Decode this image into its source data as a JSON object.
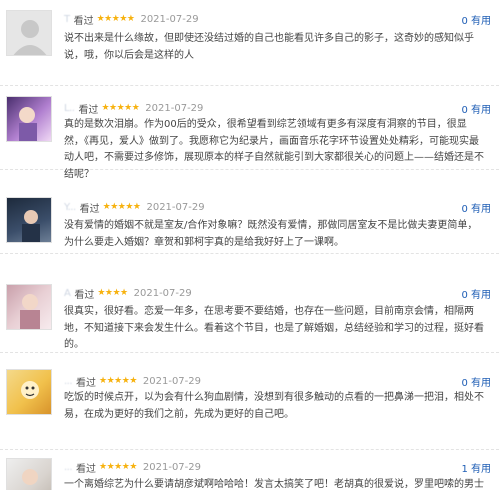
{
  "reviews": [
    {
      "user": "T",
      "action": "看过",
      "stars": "★★★★★",
      "date": "2021-07-29",
      "useful": "0 有用",
      "text": "说不出来是什么缘故，但即使还没结过婚的自己也能看见许多自己的影子，这奇妙的感知似乎说，哦，你以后会是这样的人",
      "avatar": "default-avatar"
    },
    {
      "user": "L..",
      "action": "看过",
      "stars": "★★★★★",
      "date": "2021-07-29",
      "useful": "0 有用",
      "text": "真的是数次泪崩。作为00后的受众，很希望看到综艺领域有更多有深度有洞察的节目，很显然，《再见，爱人》做到了。我愿称它为纪录片，画面音乐花字环节设置处处精彩，可能现实最动人吧，不需要过多修饰，展现原本的样子自然就能引到大家都很关心的问题上——结婚还是不结呢？",
      "avatar": "photo-avatar-purple"
    },
    {
      "user": "Y...",
      "action": "看过",
      "stars": "★★★★★",
      "date": "2021-07-29",
      "useful": "0 有用",
      "text": "没有爱情的婚姻不就是室友/合作对象嘛？既然没有爱情，那做同居室友不是比做夫妻更简单，为什么要走入婚姻？章贺和郭柯宇真的是给我好好上了一课啊。",
      "avatar": "photo-avatar-dark"
    },
    {
      "user": "A",
      "action": "看过",
      "stars": "★★★★",
      "date": "2021-07-29",
      "useful": "0 有用",
      "text": "很真实，很好看。恋爱一年多，在思考要不要结婚，也存在一些问题，目前南京会情，相隔两地，不知道接下来会发生什么。看着这个节目，也是了解婚姻，总结经验和学习的过程，挺好看的。",
      "avatar": "photo-avatar-pink"
    },
    {
      "user": "...",
      "action": "看过",
      "stars": "★★★★★",
      "date": "2021-07-29",
      "useful": "0 有用",
      "text": "吃饭的时候点开，以为会有什么狗血剧情，没想到有很多触动的点看的一把鼻涕一把泪，相处不易，在成为更好的我们之前，先成为更好的自己吧。",
      "avatar": "photo-avatar-yellow"
    },
    {
      "user": "...",
      "action": "看过",
      "stars": "★★★★★",
      "date": "2021-07-29",
      "useful": "1 有用",
      "text": "一个离婚综艺为什么要请胡彦斌啊哈哈哈！发言太搞笑了吧！老胡真的很爱说，罗里吧嗦的男士，还应可爱",
      "avatar": "photo-avatar-light"
    }
  ]
}
